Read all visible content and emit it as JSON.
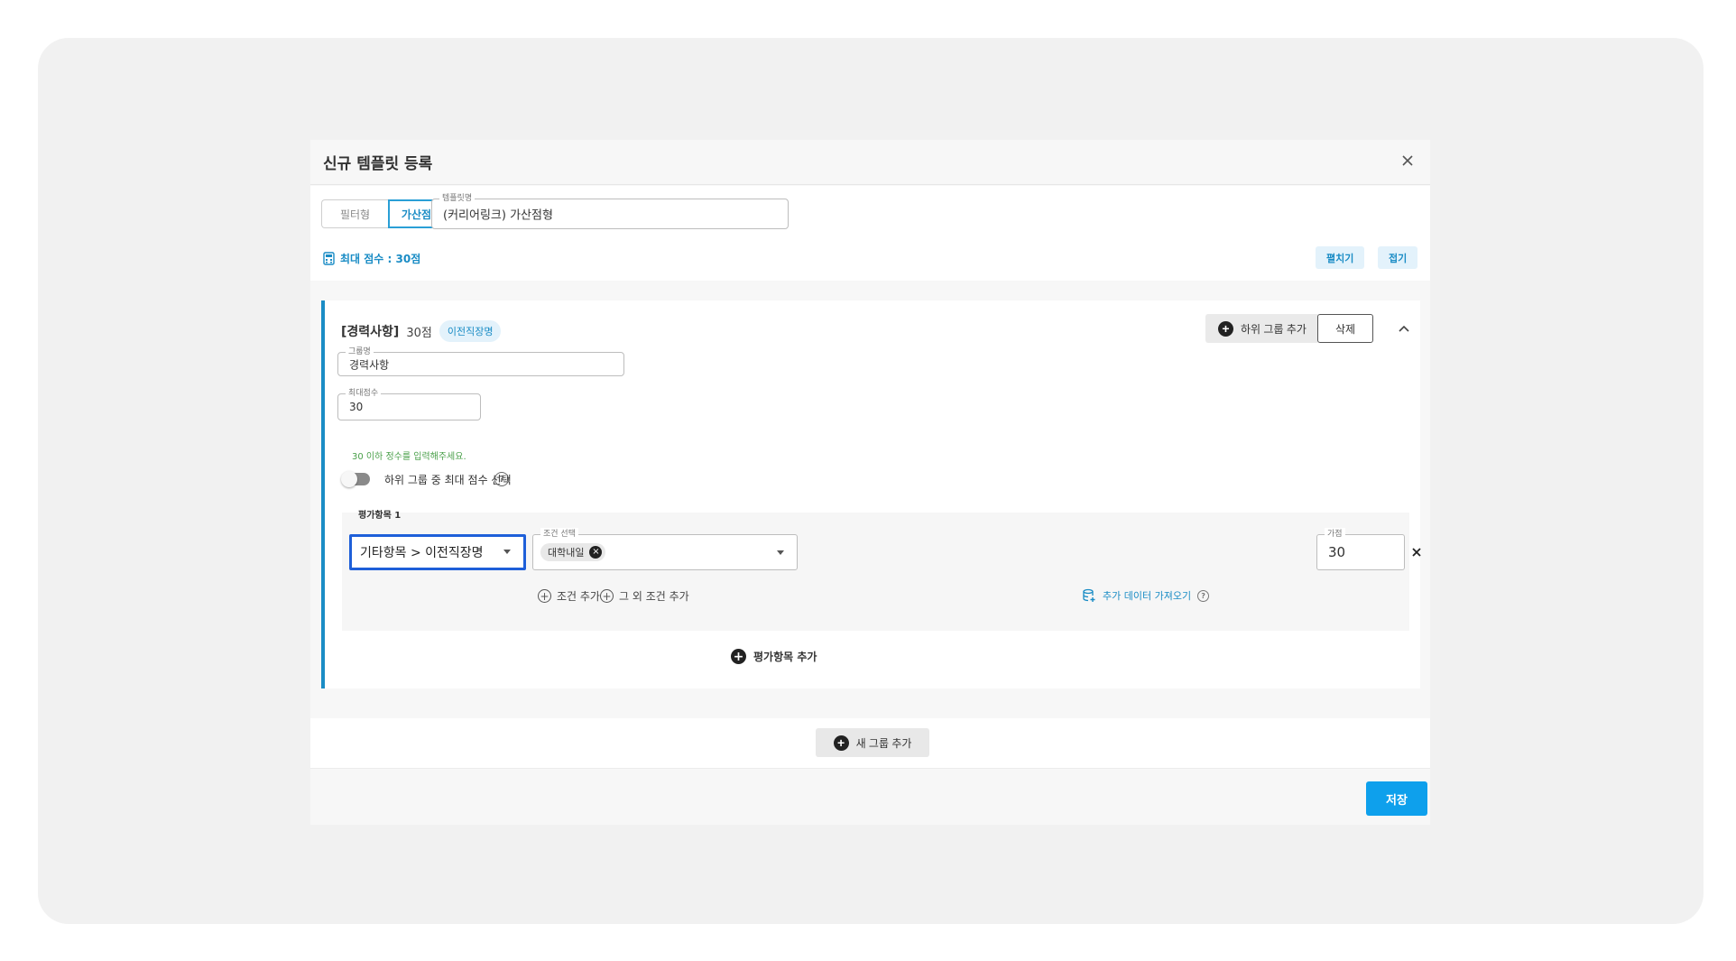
{
  "modal": {
    "title": "신규 템플릿 등록",
    "type_toggle": {
      "filter_label": "필터형",
      "bonus_label": "가산점형",
      "selected": "가산점형"
    },
    "template_name": {
      "label": "템플릿명",
      "value": "(커리어링크) 가산점형"
    },
    "max_score_label": "최대 점수 : 30점",
    "expand_label": "펼치기",
    "collapse_label": "접기"
  },
  "group": {
    "name": "[경력사항]",
    "points": "30점",
    "badge": "이전직장명",
    "add_subgroup_label": "하위 그룹 추가",
    "delete_label": "삭제",
    "group_name_field": {
      "label": "그룹명",
      "value": "경력사항"
    },
    "max_score_field": {
      "label": "최대점수",
      "value": "30"
    },
    "helper_text": "30 이하 정수를 입력해주세요.",
    "toggle_label": "하위 그룹 중 최대 점수 선택",
    "toggle_on": false,
    "eval_item": {
      "title": "평가항목 1",
      "category_value": "기타항목 > 이전직장명",
      "condition_label": "조건 선택",
      "condition_chip": "대학내일",
      "score_label": "가점",
      "score_value": "30",
      "add_condition_label": "조건 추가",
      "add_other_condition_label": "그 외 조건 추가",
      "fetch_data_label": "추가 데이터 가져오기"
    },
    "add_eval_label": "평가항목 추가"
  },
  "new_group_label": "새 그룹 추가",
  "save_label": "저장",
  "colors": {
    "accent": "#1a8cc5",
    "primary_button": "#0ea0ec",
    "focus_border": "#1e5fd9"
  }
}
